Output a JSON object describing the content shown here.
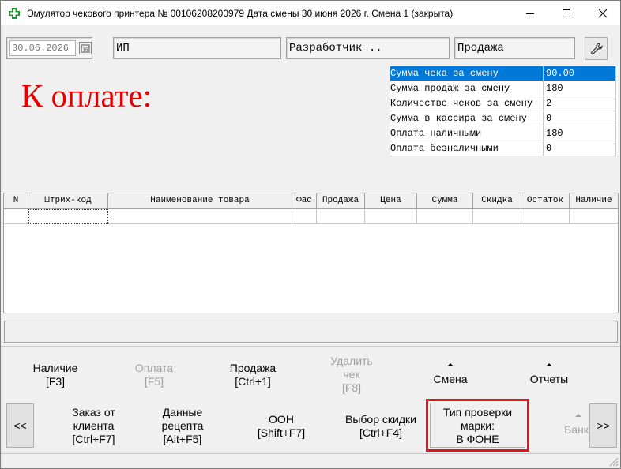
{
  "window": {
    "title": "Эмулятор чекового принтера № 00106208200979  Дата смены 30 июня 2026 г.   Смена 1 (закрыта)"
  },
  "fields": {
    "date": "30.06.2026",
    "org": "ИП",
    "cashier": "Разработчик ..",
    "operation": "Продажа"
  },
  "payment_label": "К оплате:",
  "stats": [
    {
      "name": "Сумма чека за смену",
      "value": "90.00",
      "selected": true
    },
    {
      "name": "Сумма продаж за смену",
      "value": "180",
      "selected": false
    },
    {
      "name": "Количество чеков за смену",
      "value": "2",
      "selected": false
    },
    {
      "name": "Сумма в кассира за смену",
      "value": "0",
      "selected": false
    },
    {
      "name": "Оплата наличными",
      "value": "180",
      "selected": false
    },
    {
      "name": "Оплата безналичными",
      "value": "0",
      "selected": false
    }
  ],
  "grid": {
    "columns": [
      "N",
      "Штрих-код",
      "Наименование товара",
      "Фас",
      "Продажа",
      "Цена",
      "Сумма",
      "Скидка",
      "Остаток",
      "Наличие"
    ]
  },
  "buttons_row1": {
    "cash": {
      "line1": "Наличие",
      "line2": "[F3]"
    },
    "payment": {
      "line1": "Оплата",
      "line2": "[F5]"
    },
    "sale": {
      "line1": "Продажа",
      "line2": "[Ctrl+1]"
    },
    "delete_check": {
      "line1": "Удалить",
      "line2": "чек",
      "line3": "[F8]"
    },
    "shift": {
      "line1": "Смена"
    },
    "reports": {
      "line1": "Отчеты"
    }
  },
  "buttons_row2": {
    "prev": "<<",
    "order": {
      "line1": "Заказ от",
      "line2": "клиента",
      "line3": "[Ctrl+F7]"
    },
    "recipe": {
      "line1": "Данные",
      "line2": "рецепта",
      "line3": "[Alt+F5]"
    },
    "oon": {
      "line1": "ООН",
      "line2": "[Shift+F7]"
    },
    "discount": {
      "line1": "Выбор скидки",
      "line2": "[Ctrl+F4]"
    },
    "check_type": {
      "line1": "Тип проверки",
      "line2": "марки:",
      "line3": "В ФОНЕ"
    },
    "bank": {
      "line1": "Банк"
    },
    "next": ">>"
  },
  "colors": {
    "accent": "#0078d7",
    "payment_label": "#e60000",
    "highlight_border": "#e0161b"
  }
}
